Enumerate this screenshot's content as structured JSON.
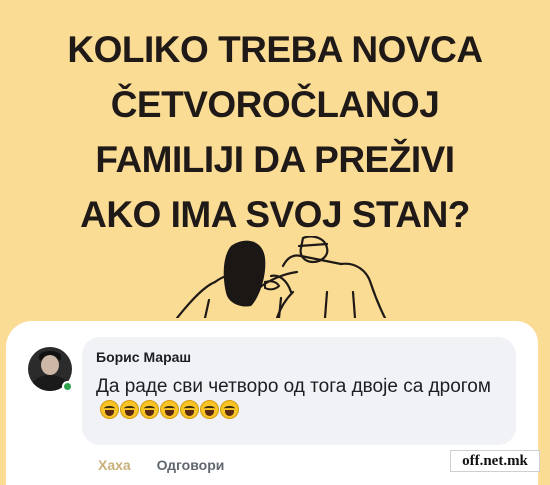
{
  "poster": {
    "headline_lines": [
      "KOLIKO TREBA NOVCA",
      "ČETVOROČLANOJ",
      "FAMILIJI DA PREŽIVI",
      "AKO IMA SVOJ STAN?"
    ],
    "background_color": "#fbdc95"
  },
  "comment": {
    "author": "Борис Мараш",
    "text": "Да раде сви четворо од тога двоје са дрогом",
    "emoji": "laughing-face",
    "emoji_count": 7,
    "online_status_color": "#31a24c",
    "actions": {
      "haha_label": "Хаха",
      "reply_label": "Одговори"
    }
  },
  "watermark": {
    "text": "off.net.mk"
  }
}
